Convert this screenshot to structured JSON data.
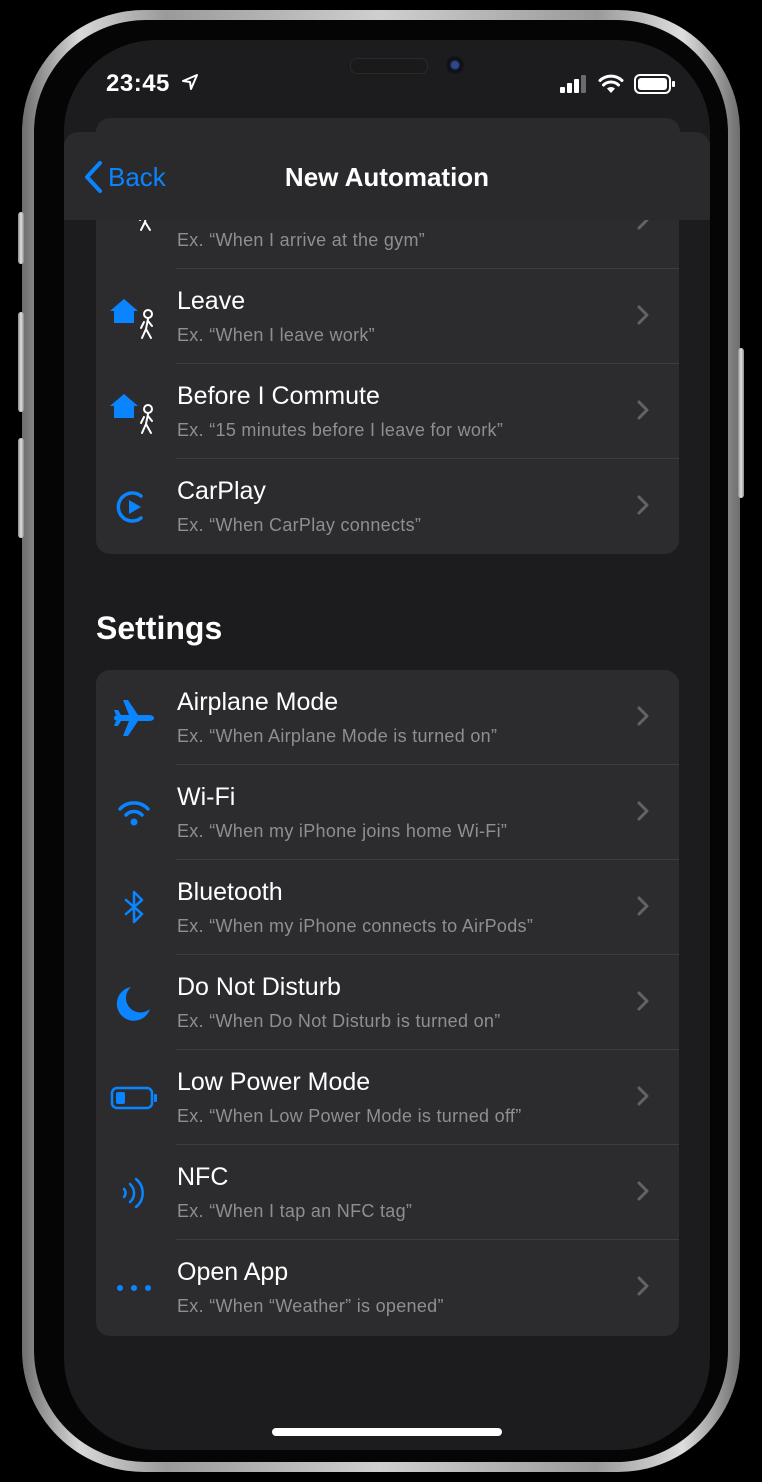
{
  "status_bar": {
    "time": "23:45",
    "location_icon": "location-arrow-icon",
    "signal_icon": "cellular-signal-icon",
    "wifi_icon": "wifi-status-icon",
    "battery_icon": "battery-icon"
  },
  "nav": {
    "back_label": "Back",
    "title": "New Automation"
  },
  "location_group": {
    "rows": [
      {
        "title": "",
        "subtitle": "Ex. “When I arrive at the gym”",
        "icon": "arrive-icon"
      },
      {
        "title": "Leave",
        "subtitle": "Ex. “When I leave work”",
        "icon": "leave-home-icon"
      },
      {
        "title": "Before I Commute",
        "subtitle": "Ex. “15 minutes before I leave for work”",
        "icon": "commute-icon"
      },
      {
        "title": "CarPlay",
        "subtitle": "Ex. “When CarPlay connects”",
        "icon": "carplay-icon"
      }
    ]
  },
  "settings_section": {
    "header": "Settings",
    "rows": [
      {
        "title": "Airplane Mode",
        "subtitle": "Ex. “When Airplane Mode is turned on”",
        "icon": "airplane-icon"
      },
      {
        "title": "Wi-Fi",
        "subtitle": "Ex. “When my iPhone joins home Wi-Fi”",
        "icon": "wifi-icon"
      },
      {
        "title": "Bluetooth",
        "subtitle": "Ex. “When my iPhone connects to AirPods”",
        "icon": "bluetooth-icon"
      },
      {
        "title": "Do Not Disturb",
        "subtitle": "Ex. “When Do Not Disturb is turned on”",
        "icon": "moon-icon"
      },
      {
        "title": "Low Power Mode",
        "subtitle": "Ex. “When Low Power Mode is turned off”",
        "icon": "low-battery-icon"
      },
      {
        "title": "NFC",
        "subtitle": "Ex. “When I tap an NFC tag”",
        "icon": "nfc-icon"
      },
      {
        "title": "Open App",
        "subtitle": "Ex. “When “Weather” is opened”",
        "icon": "ellipsis-icon"
      }
    ]
  },
  "colors": {
    "accent": "#0a84ff",
    "background": "#1c1c1e",
    "cell": "#2c2c2e",
    "secondary_text": "#8e8e93"
  }
}
